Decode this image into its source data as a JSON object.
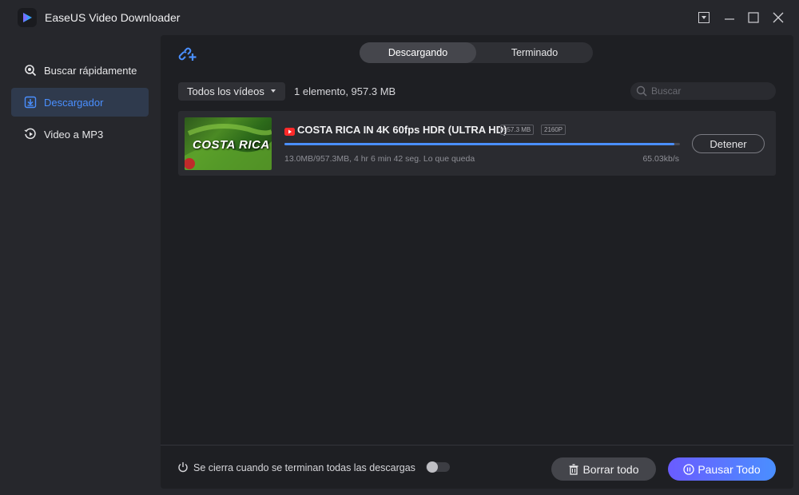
{
  "window": {
    "title": "EaseUS Video Downloader"
  },
  "sidebar": {
    "items": [
      {
        "label": "Buscar rápidamente",
        "icon": "search-icon"
      },
      {
        "label": "Descargador",
        "icon": "download-icon",
        "active": true
      },
      {
        "label": "Video a MP3",
        "icon": "audio-convert-icon"
      }
    ]
  },
  "tabs": [
    {
      "label": "Descargando",
      "active": true
    },
    {
      "label": "Terminado",
      "active": false
    }
  ],
  "toolbar": {
    "filter_value": "Todos los vídeos",
    "count_text": "1 elemento, 957.3 MB",
    "search_placeholder": "Buscar"
  },
  "downloads": [
    {
      "thumbnail_text": "COSTA RICA",
      "source_icon": "youtube-icon",
      "title": "COSTA RICA IN 4K 60fps HDR (ULTRA HD)",
      "size_badge": "957.3 MB",
      "resolution_badge": "2160P",
      "progress": 0.986,
      "status_text": "13.0MB/957.3MB, 4 hr 6 min 42 seg. Lo que queda",
      "speed": "65.03kb/s",
      "action_label": "Detener"
    }
  ],
  "footer": {
    "auto_close_text": "Se cierra cuando se terminan todas las descargas",
    "auto_close_enabled": false,
    "clear_label": "Borrar todo",
    "pause_label": "Pausar Todo"
  },
  "colors": {
    "accent": "#4a8fff",
    "pause_gradient_start": "#6a5cff",
    "background": "#26272c",
    "panel": "#1e1f23"
  }
}
